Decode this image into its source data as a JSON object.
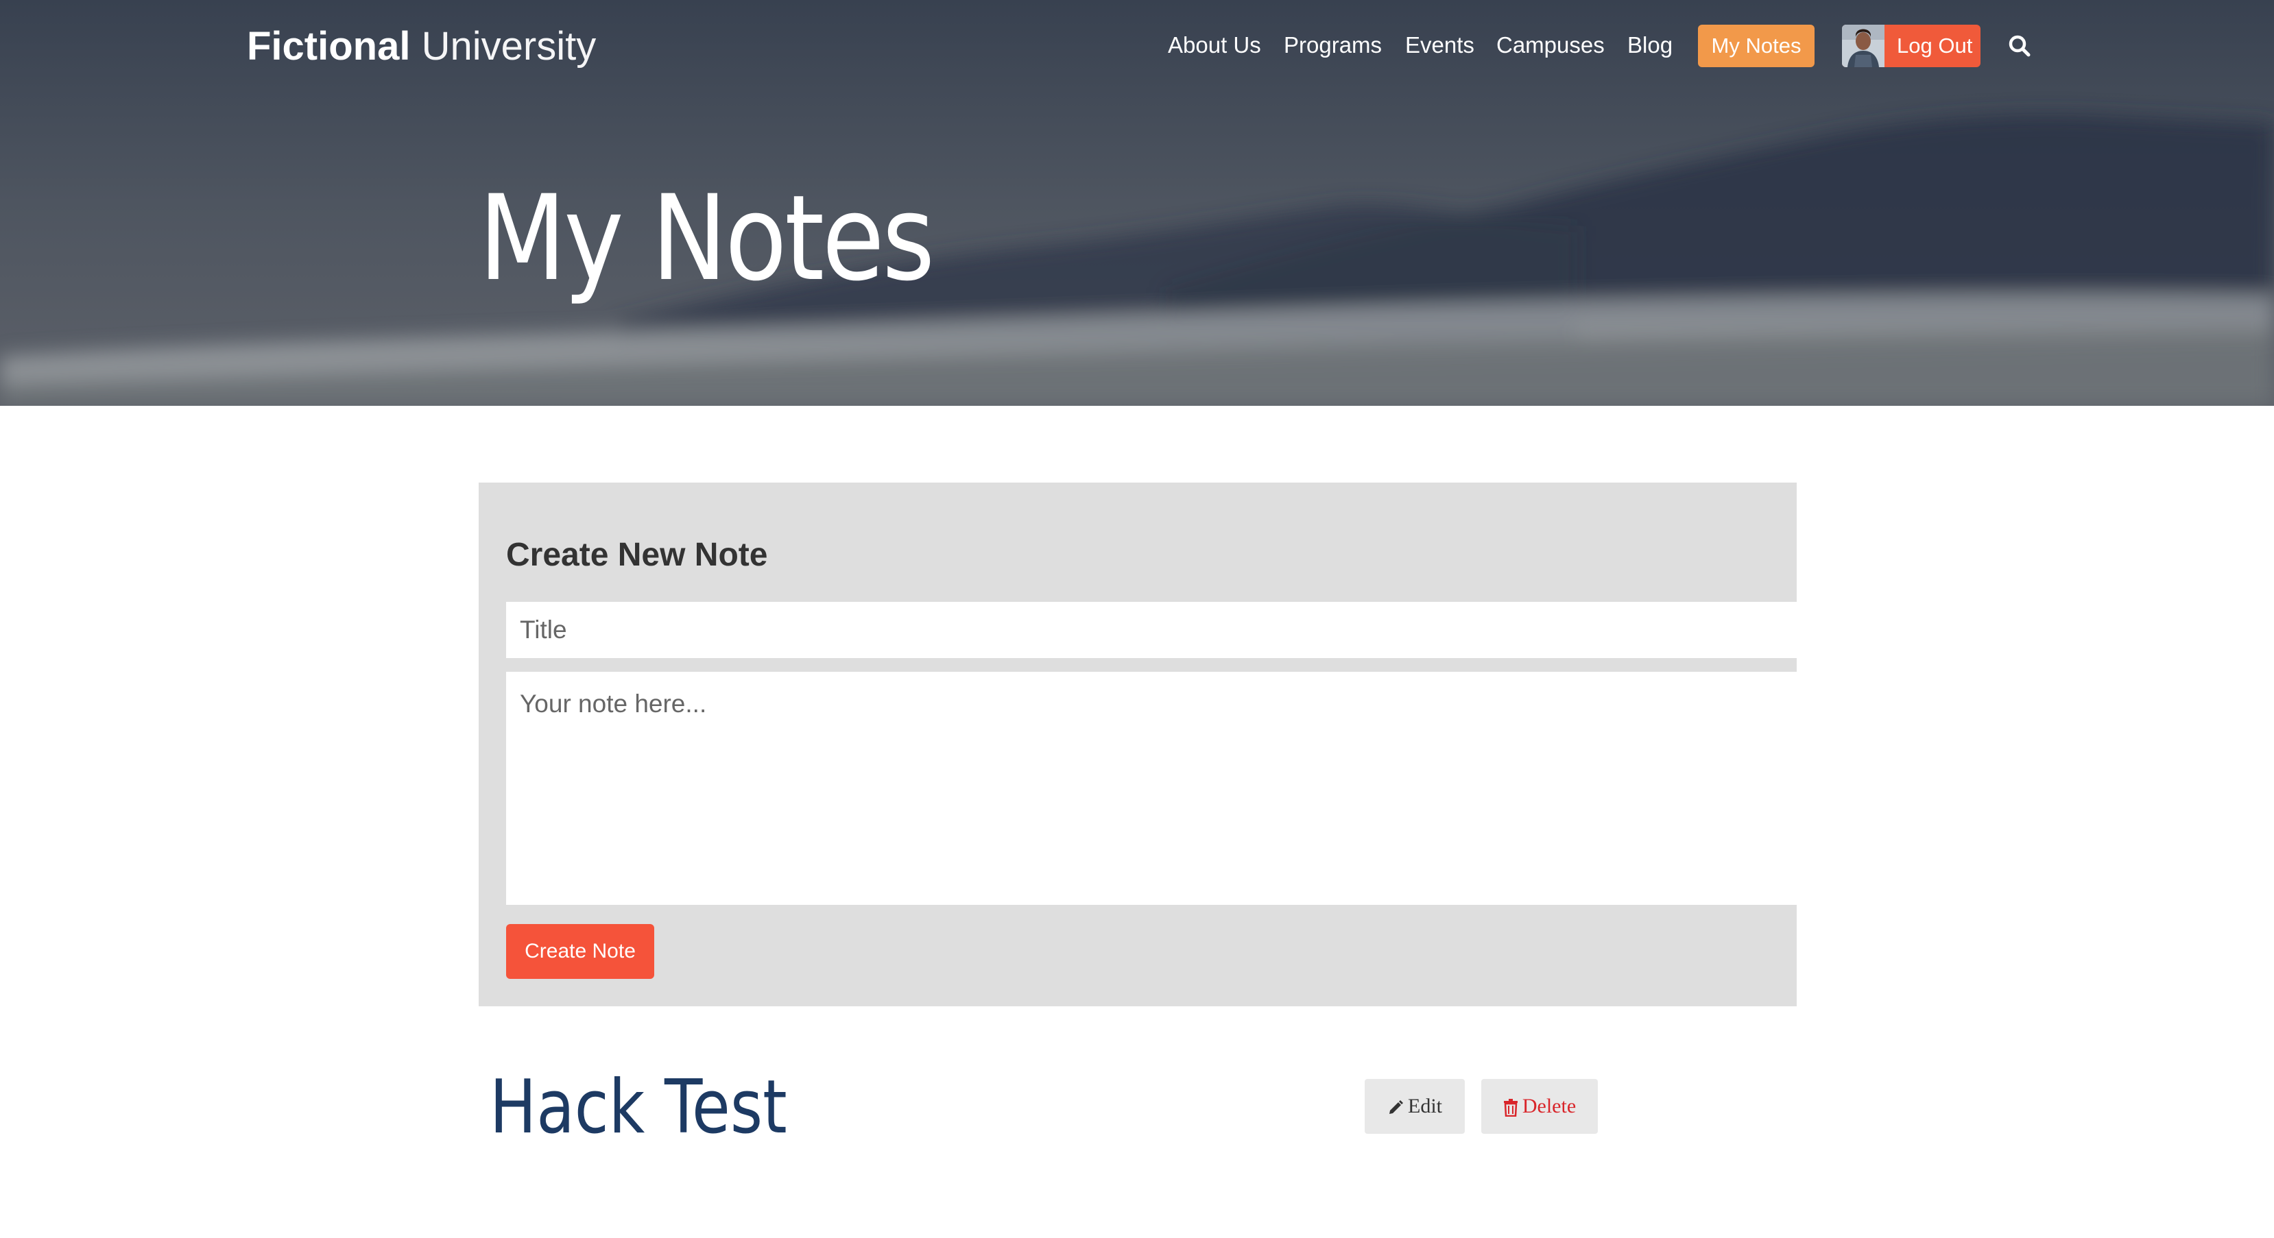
{
  "header": {
    "brand_bold": "Fictional",
    "brand_light": "University",
    "nav": [
      "About Us",
      "Programs",
      "Events",
      "Campuses",
      "Blog"
    ],
    "my_notes": "My Notes",
    "logout": "Log Out"
  },
  "hero": {
    "title": "My Notes"
  },
  "create_form": {
    "heading": "Create New Note",
    "title_placeholder": "Title",
    "body_placeholder": "Your note here...",
    "submit": "Create Note"
  },
  "notes": [
    {
      "title": "Hack Test",
      "edit": "Edit",
      "delete": "Delete"
    }
  ],
  "colors": {
    "my_notes_btn": "#f2994a",
    "logout_btn": "#f05a3a",
    "create_btn": "#f5533a",
    "note_title": "#1d3a63",
    "delete_text": "#d9252a",
    "panel_bg": "#dedede"
  },
  "icons": [
    "search-icon",
    "pencil-icon",
    "trash-icon",
    "user-avatar"
  ]
}
